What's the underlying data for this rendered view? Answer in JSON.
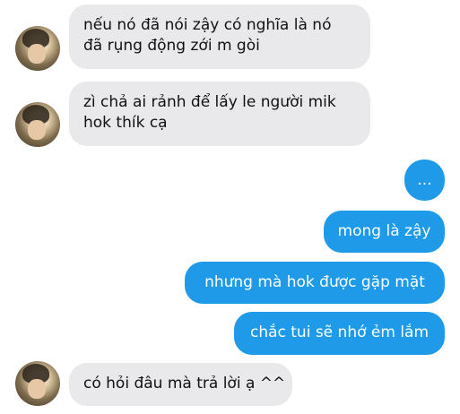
{
  "messages": [
    {
      "sender": "them",
      "lines": [
        "nếu nó đã nói zậy có nghĩa là nó",
        "đã rụng động zới m gòi"
      ]
    },
    {
      "sender": "them",
      "lines": [
        "zì chả ai rảnh để lấy le người mik",
        "hok thík cạ"
      ]
    },
    {
      "sender": "me",
      "lines": [
        "..."
      ]
    },
    {
      "sender": "me",
      "lines": [
        "mong là zậy"
      ]
    },
    {
      "sender": "me",
      "lines": [
        "nhưng mà hok được gặp mặt"
      ]
    },
    {
      "sender": "me",
      "lines": [
        "chắc tui sẽ nhớ ẻm lắm"
      ]
    },
    {
      "sender": "them",
      "lines": [
        "có hỏi đâu mà trả lời ạ ^^"
      ]
    }
  ],
  "icons": {
    "contact_avatar": "contact-avatar"
  },
  "colors": {
    "incoming_bubble": "#e9e9eb",
    "outgoing_bubble": "#1e9ae9"
  }
}
